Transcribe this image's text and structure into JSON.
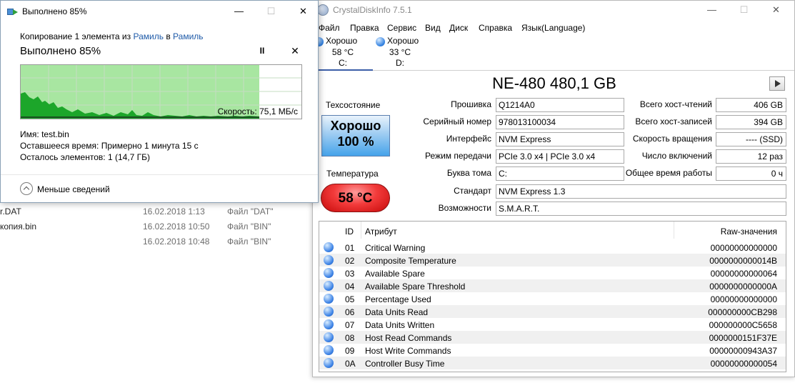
{
  "explorer": {
    "rows": [
      {
        "name": "r.DAT",
        "date": "16.02.2018 1:13",
        "type": "Файл \"DAT\""
      },
      {
        "name": "копия.bin",
        "date": "16.02.2018 10:50",
        "type": "Файл \"BIN\""
      },
      {
        "name": "",
        "date": "16.02.2018 10:48",
        "type": "Файл \"BIN\""
      }
    ]
  },
  "copy_dialog": {
    "title": "Выполнено 85%",
    "copying_prefix": "Копирование 1 элемента из",
    "source": "Рамиль",
    "in_word": "в",
    "dest": "Рамиль",
    "percent_text": "Выполнено 85%",
    "progress_percent": 85,
    "speed_text": "Скорость: 75,1 МБ/с",
    "name_label": "Имя:",
    "name_value": "test.bin",
    "time_label": "Оставшееся время:",
    "time_value": "Примерно 1 минута 15 с",
    "items_label": "Осталось элементов:",
    "items_value": "1 (14,7 ГБ)",
    "less_details": "Меньше сведений",
    "pause_glyph": "II",
    "close_glyph": "✕",
    "win_minimize": "—",
    "win_maximize": "☐",
    "win_close": "✕"
  },
  "cdi": {
    "title": "CrystalDiskInfo 7.5.1",
    "win_minimize": "—",
    "win_maximize": "☐",
    "win_close": "✕",
    "menu": [
      "Файл",
      "Правка",
      "Сервис",
      "Вид",
      "Диск",
      "Справка",
      "Язык(Language)"
    ],
    "drives": [
      {
        "status": "Хорошо",
        "temp": "58 °C",
        "letter": "C:"
      },
      {
        "status": "Хорошо",
        "temp": "33 °C",
        "letter": "D:"
      }
    ],
    "model": "NE-480 480,1 GB",
    "health_label": "Техсостояние",
    "health_status": "Хорошо",
    "health_percent": "100 %",
    "temp_label": "Температура",
    "temp_value": "58 °C",
    "fields_left": [
      {
        "label": "Прошивка",
        "value": "Q1214A0"
      },
      {
        "label": "Серийный номер",
        "value": "978013100034"
      },
      {
        "label": "Интерфейс",
        "value": "NVM Express"
      },
      {
        "label": "Режим передачи",
        "value": "PCIe 3.0 x4 | PCIe 3.0 x4"
      },
      {
        "label": "Буква тома",
        "value": "C:"
      }
    ],
    "fields_right": [
      {
        "label": "Всего хост-чтений",
        "value": "406 GB"
      },
      {
        "label": "Всего хост-записей",
        "value": "394 GB"
      },
      {
        "label": "Скорость вращения",
        "value": "---- (SSD)"
      },
      {
        "label": "Число включений",
        "value": "12 раз"
      },
      {
        "label": "Общее время работы",
        "value": "0 ч"
      }
    ],
    "standard_label": "Стандарт",
    "standard_value": "NVM Express 1.3",
    "features_label": "Возможности",
    "features_value": "S.M.A.R.T.",
    "smart_headers": {
      "id": "ID",
      "attr": "Атрибут",
      "raw": "Raw-значения"
    },
    "smart_rows": [
      {
        "id": "01",
        "name": "Critical Warning",
        "raw": "00000000000000"
      },
      {
        "id": "02",
        "name": "Composite Temperature",
        "raw": "0000000000014B"
      },
      {
        "id": "03",
        "name": "Available Spare",
        "raw": "00000000000064"
      },
      {
        "id": "04",
        "name": "Available Spare Threshold",
        "raw": "0000000000000A"
      },
      {
        "id": "05",
        "name": "Percentage Used",
        "raw": "00000000000000"
      },
      {
        "id": "06",
        "name": "Data Units Read",
        "raw": "000000000CB298"
      },
      {
        "id": "07",
        "name": "Data Units Written",
        "raw": "000000000C5658"
      },
      {
        "id": "08",
        "name": "Host Read Commands",
        "raw": "0000000151F37E"
      },
      {
        "id": "09",
        "name": "Host Write Commands",
        "raw": "00000000943A37"
      },
      {
        "id": "0A",
        "name": "Controller Busy Time",
        "raw": "00000000000054"
      }
    ]
  }
}
